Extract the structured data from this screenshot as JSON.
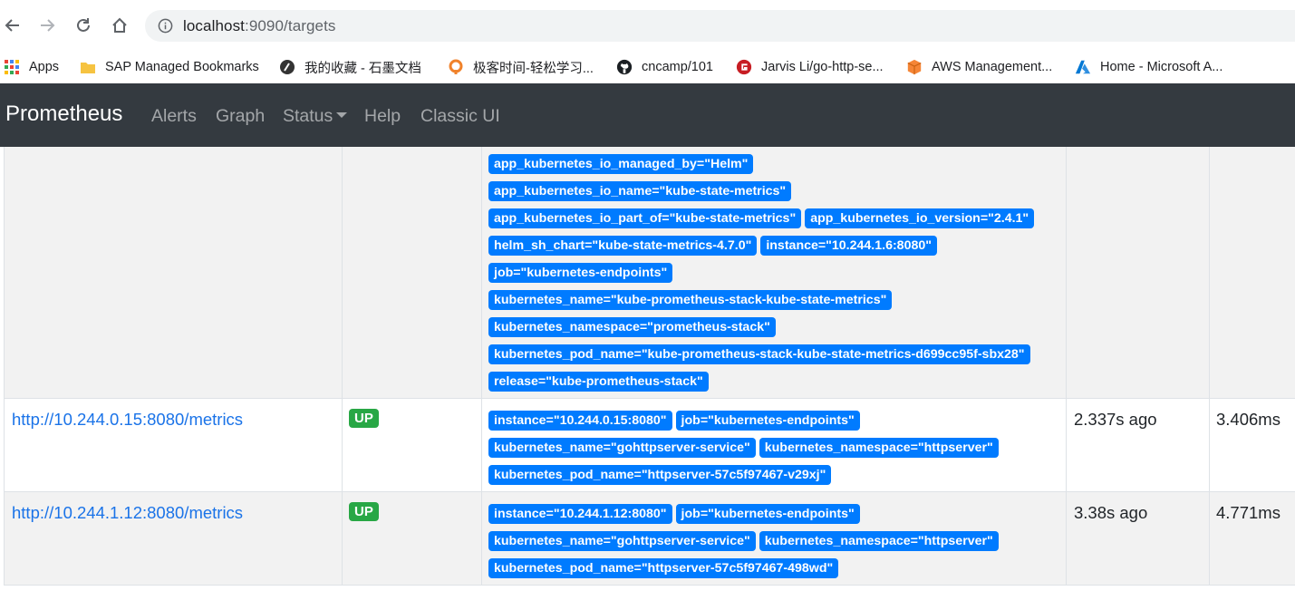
{
  "browser": {
    "url_host": "localhost",
    "url_rest": ":9090/targets",
    "bookmarks": [
      {
        "label": "Apps",
        "icon": "apps-grid-icon"
      },
      {
        "label": "SAP Managed Bookmarks",
        "icon": "folder-icon"
      },
      {
        "label": "我的收藏 - 石墨文档",
        "icon": "shimo-icon"
      },
      {
        "label": "极客时间-轻松学习...",
        "icon": "geektime-icon"
      },
      {
        "label": "cncamp/101",
        "icon": "github-icon"
      },
      {
        "label": "Jarvis Li/go-http-se...",
        "icon": "gitee-icon"
      },
      {
        "label": "AWS Management...",
        "icon": "aws-icon"
      },
      {
        "label": "Home - Microsoft A...",
        "icon": "azure-icon"
      }
    ]
  },
  "navbar": {
    "brand": "Prometheus",
    "links": [
      "Alerts",
      "Graph",
      "Status",
      "Help",
      "Classic UI"
    ]
  },
  "targets": {
    "partial_row": {
      "labels": [
        "app_kubernetes_io_managed_by=\"Helm\"",
        "app_kubernetes_io_name=\"kube-state-metrics\"",
        "app_kubernetes_io_part_of=\"kube-state-metrics\"",
        "app_kubernetes_io_version=\"2.4.1\"",
        "helm_sh_chart=\"kube-state-metrics-4.7.0\"",
        "instance=\"10.244.1.6:8080\"",
        "job=\"kubernetes-endpoints\"",
        "kubernetes_name=\"kube-prometheus-stack-kube-state-metrics\"",
        "kubernetes_namespace=\"prometheus-stack\"",
        "kubernetes_pod_name=\"kube-prometheus-stack-kube-state-metrics-d699cc95f-sbx28\"",
        "release=\"kube-prometheus-stack\""
      ]
    },
    "rows": [
      {
        "endpoint": "http://10.244.0.15:8080/metrics",
        "state": "UP",
        "labels": [
          "instance=\"10.244.0.15:8080\"",
          "job=\"kubernetes-endpoints\"",
          "kubernetes_name=\"gohttpserver-service\"",
          "kubernetes_namespace=\"httpserver\"",
          "kubernetes_pod_name=\"httpserver-57c5f97467-v29xj\""
        ],
        "last_scrape": "2.337s ago",
        "duration": "3.406ms"
      },
      {
        "endpoint": "http://10.244.1.12:8080/metrics",
        "state": "UP",
        "labels": [
          "instance=\"10.244.1.12:8080\"",
          "job=\"kubernetes-endpoints\"",
          "kubernetes_name=\"gohttpserver-service\"",
          "kubernetes_namespace=\"httpserver\"",
          "kubernetes_pod_name=\"httpserver-57c5f97467-498wd\""
        ],
        "last_scrape": "3.38s ago",
        "duration": "4.771ms"
      }
    ]
  },
  "colors": {
    "navbar_bg": "#343a40",
    "label_badge": "#007bff",
    "up_badge": "#28a745",
    "link": "#1a73e8"
  }
}
